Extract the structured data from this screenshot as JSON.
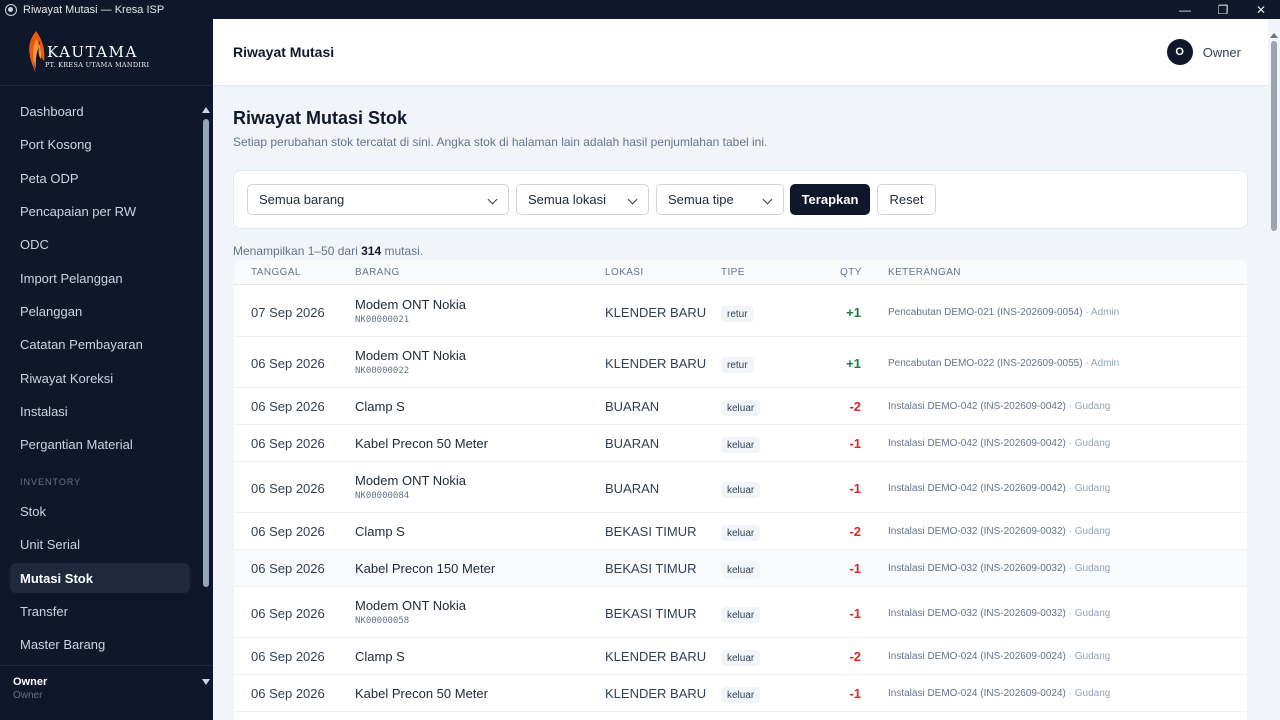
{
  "window": {
    "title": "Riwayat Mutasi — Kresa ISP"
  },
  "brand": {
    "name": "KAUTAMA",
    "tagline": "PT. KRESA UTAMA MANDIRI",
    "accent": "#ea580c"
  },
  "sidebar": {
    "items": [
      {
        "label": "Dashboard"
      },
      {
        "label": "Port Kosong"
      },
      {
        "label": "Peta ODP"
      },
      {
        "label": "Pencapaian per RW"
      },
      {
        "label": "ODC"
      },
      {
        "label": "Import Pelanggan"
      },
      {
        "label": "Pelanggan"
      },
      {
        "label": "Catatan Pembayaran"
      },
      {
        "label": "Riwayat Koreksi"
      },
      {
        "label": "Instalasi"
      },
      {
        "label": "Pergantian Material"
      }
    ],
    "section_label": "INVENTORY",
    "inventory_items": [
      {
        "label": "Stok"
      },
      {
        "label": "Unit Serial"
      },
      {
        "label": "Mutasi Stok",
        "active": true
      },
      {
        "label": "Transfer"
      },
      {
        "label": "Master Barang"
      }
    ],
    "footer": {
      "name": "Owner",
      "role": "Owner"
    }
  },
  "header": {
    "title": "Riwayat Mutasi",
    "user_initial": "O",
    "user_name": "Owner"
  },
  "page": {
    "title": "Riwayat Mutasi Stok",
    "subtitle": "Setiap perubahan stok tercatat di sini. Angka stok di halaman lain adalah hasil penjumlahan tabel ini."
  },
  "filters": {
    "item": "Semua barang",
    "location": "Semua lokasi",
    "type": "Semua tipe",
    "apply_label": "Terapkan",
    "reset_label": "Reset"
  },
  "summary": {
    "prefix": "Menampilkan 1–50 dari",
    "count": "314",
    "suffix": "mutasi."
  },
  "table": {
    "headers": [
      "TANGGAL",
      "BARANG",
      "LOKASI",
      "TIPE",
      "QTY",
      "KETERANGAN"
    ],
    "rows": [
      {
        "date": "07 Sep 2026",
        "item": "Modem ONT Nokia",
        "serial": "NK00000021",
        "location": "KLENDER BARU",
        "type": "retur",
        "qty": "+1",
        "note": "Pencabutan DEMO-021 (INS-202609-0054)",
        "by": "· Admin"
      },
      {
        "date": "06 Sep 2026",
        "item": "Modem ONT Nokia",
        "serial": "NK00000022",
        "location": "KLENDER BARU",
        "type": "retur",
        "qty": "+1",
        "note": "Pencabutan DEMO-022 (INS-202609-0055)",
        "by": "· Admin"
      },
      {
        "date": "06 Sep 2026",
        "item": "Clamp S",
        "serial": "",
        "location": "BUARAN",
        "type": "keluar",
        "qty": "-2",
        "note": "Instalasi DEMO-042 (INS-202609-0042)",
        "by": "· Gudang"
      },
      {
        "date": "06 Sep 2026",
        "item": "Kabel Precon 50 Meter",
        "serial": "",
        "location": "BUARAN",
        "type": "keluar",
        "qty": "-1",
        "note": "Instalasi DEMO-042 (INS-202609-0042)",
        "by": "· Gudang"
      },
      {
        "date": "06 Sep 2026",
        "item": "Modem ONT Nokia",
        "serial": "NK00000084",
        "location": "BUARAN",
        "type": "keluar",
        "qty": "-1",
        "note": "Instalasi DEMO-042 (INS-202609-0042)",
        "by": "· Gudang"
      },
      {
        "date": "06 Sep 2026",
        "item": "Clamp S",
        "serial": "",
        "location": "BEKASI TIMUR",
        "type": "keluar",
        "qty": "-2",
        "note": "Instalasi DEMO-032 (INS-202609-0032)",
        "by": "· Gudang"
      },
      {
        "date": "06 Sep 2026",
        "item": "Kabel Precon 150 Meter",
        "serial": "",
        "location": "BEKASI TIMUR",
        "type": "keluar",
        "qty": "-1",
        "note": "Instalasi DEMO-032 (INS-202609-0032)",
        "by": "· Gudang"
      },
      {
        "date": "06 Sep 2026",
        "item": "Modem ONT Nokia",
        "serial": "NK00000058",
        "location": "BEKASI TIMUR",
        "type": "keluar",
        "qty": "-1",
        "note": "Instalasi DEMO-032 (INS-202609-0032)",
        "by": "· Gudang"
      },
      {
        "date": "06 Sep 2026",
        "item": "Clamp S",
        "serial": "",
        "location": "KLENDER BARU",
        "type": "keluar",
        "qty": "-2",
        "note": "Instalasi DEMO-024 (INS-202609-0024)",
        "by": "· Gudang"
      },
      {
        "date": "06 Sep 2026",
        "item": "Kabel Precon 50 Meter",
        "serial": "",
        "location": "KLENDER BARU",
        "type": "keluar",
        "qty": "-1",
        "note": "Instalasi DEMO-024 (INS-202609-0024)",
        "by": "· Gudang"
      }
    ]
  }
}
